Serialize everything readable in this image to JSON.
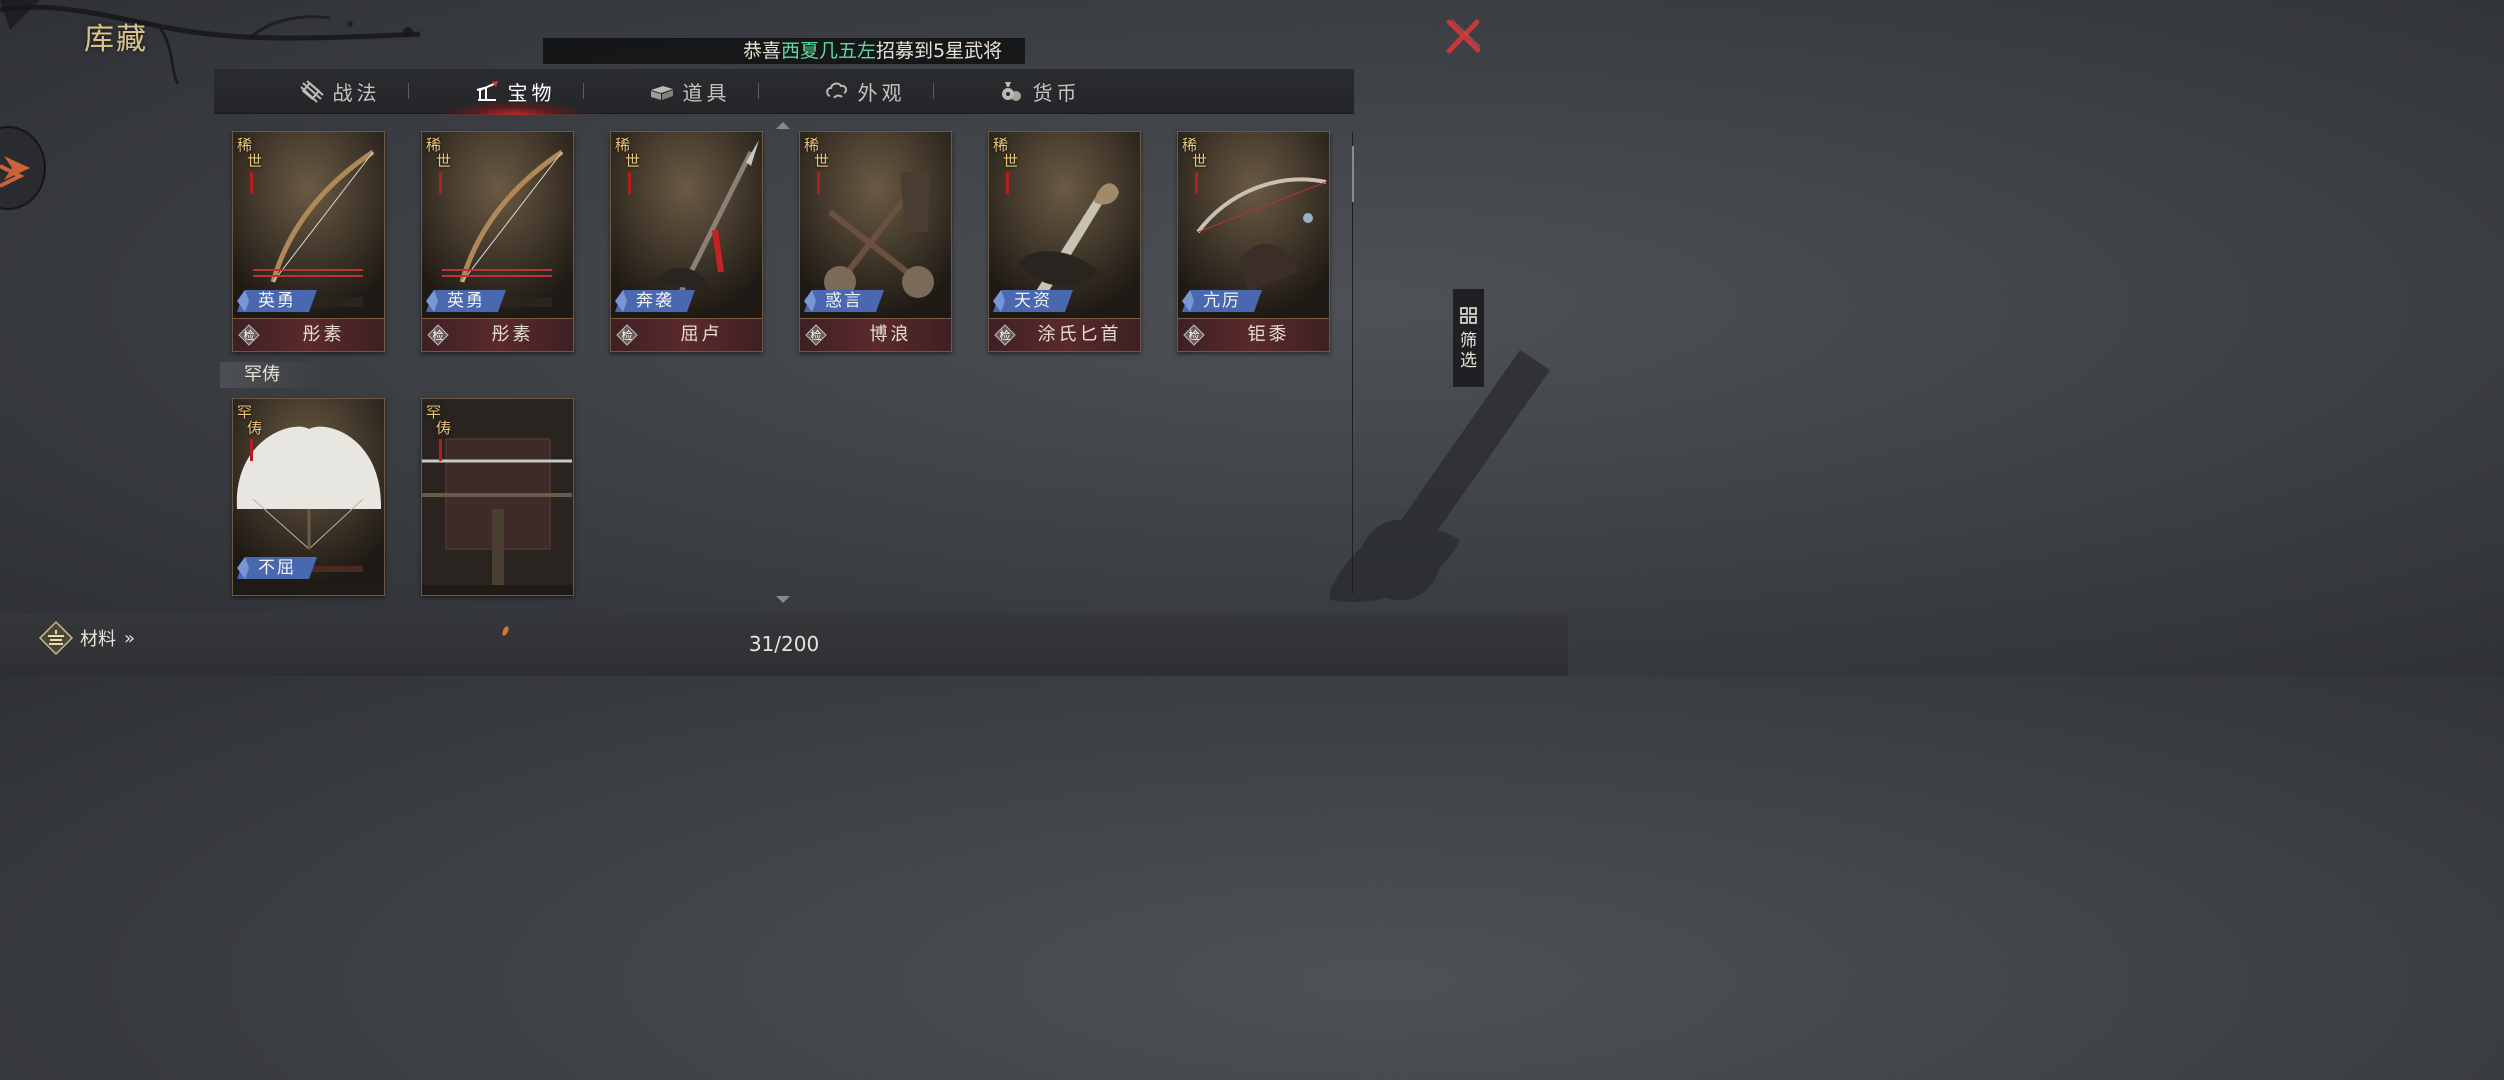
{
  "title": "库藏",
  "ticker": {
    "prefix": "恭喜",
    "highlight": "西夏几五左",
    "suffix": "招募到5星武将"
  },
  "tabs": [
    {
      "label": "战法",
      "icon": "scroll-icon",
      "active": false
    },
    {
      "label": "宝物",
      "icon": "treasure-icon",
      "active": true
    },
    {
      "label": "道具",
      "icon": "box-icon",
      "active": false
    },
    {
      "label": "外观",
      "icon": "cloud-icon",
      "active": false
    },
    {
      "label": "货币",
      "icon": "coin-bag-icon",
      "active": false
    }
  ],
  "rare_cards": [
    {
      "grade": [
        "稀",
        "世"
      ],
      "trait": "英勇",
      "name": "彤素",
      "art": "bow"
    },
    {
      "grade": [
        "稀",
        "世"
      ],
      "trait": "英勇",
      "name": "彤素",
      "art": "bow"
    },
    {
      "grade": [
        "稀",
        "世"
      ],
      "trait": "奔袭",
      "name": "屈卢",
      "art": "spear"
    },
    {
      "grade": [
        "稀",
        "世"
      ],
      "trait": "惑言",
      "name": "博浪",
      "art": "hammers"
    },
    {
      "grade": [
        "稀",
        "世"
      ],
      "trait": "天资",
      "name": "涂氏匕首",
      "art": "dagger"
    },
    {
      "grade": [
        "稀",
        "世"
      ],
      "trait": "亢厉",
      "name": "钜黍",
      "art": "crossbow"
    }
  ],
  "section_label": "罕俦",
  "uncommon_cards": [
    {
      "grade": [
        "罕",
        "俦"
      ],
      "trait": "不屈",
      "art": "fan"
    },
    {
      "grade": [
        "罕",
        "俦"
      ],
      "art": "sword"
    }
  ],
  "namebar_mark": "检",
  "filter_label": "筛选",
  "materials_label": "材料",
  "count": "31/200",
  "colors": {
    "accent_gold": "#d9c28a",
    "close_red": "#c4373a",
    "highlight_green": "#5fd8a0",
    "trait_blue": "#4a68b0"
  }
}
